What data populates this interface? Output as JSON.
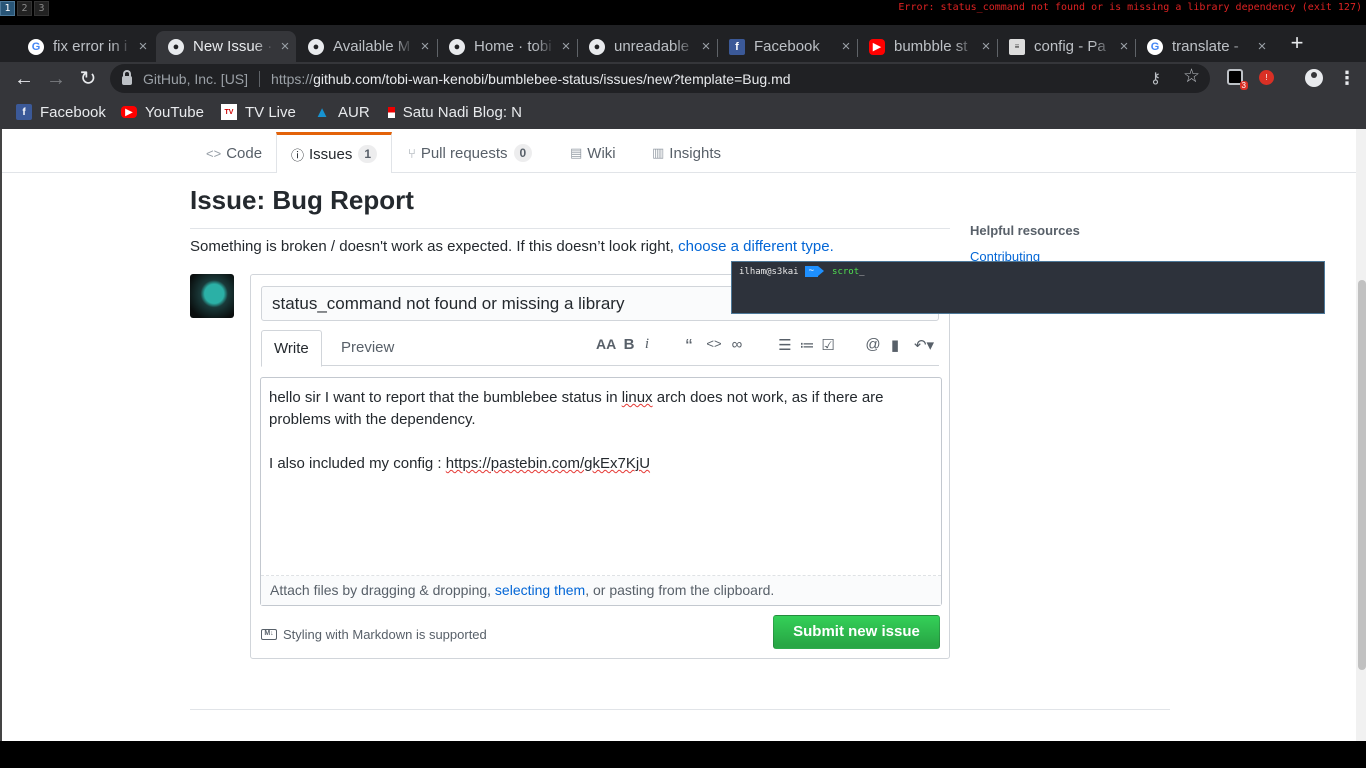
{
  "wm": {
    "workspaces": [
      "1",
      "2",
      "3"
    ],
    "active_workspace": "1",
    "status_text": "Error: status_command not found or is missing a library dependency (exit 127)"
  },
  "browser": {
    "tabs": [
      {
        "label": "fix error in i",
        "icon": "google-icon"
      },
      {
        "label": "New Issue · t",
        "icon": "github-icon",
        "active": true
      },
      {
        "label": "Available M",
        "icon": "github-icon"
      },
      {
        "label": "Home · tobi",
        "icon": "github-icon"
      },
      {
        "label": "unreadable",
        "icon": "github-icon"
      },
      {
        "label": "Facebook",
        "icon": "facebook-icon"
      },
      {
        "label": "bumbble st",
        "icon": "youtube-icon"
      },
      {
        "label": "config - Pa",
        "icon": "pastebin-icon"
      },
      {
        "label": "translate -",
        "icon": "google-icon"
      }
    ],
    "tab_close_glyph": "×",
    "new_tab_glyph": "+",
    "site_identity": "GitHub, Inc. [US]",
    "url_scheme": "https://",
    "url_host": "github.com",
    "url_path": "/tobi-wan-kenobi/bumblebee-status/issues/new?template=Bug.md",
    "ext_badge": "3",
    "ext2_label": "!",
    "bookmarks": [
      {
        "label": "Facebook",
        "icon": "facebook-icon"
      },
      {
        "label": "YouTube",
        "icon": "youtube-icon"
      },
      {
        "label": "TV Live",
        "icon": "tv-icon"
      },
      {
        "label": "AUR",
        "icon": "arch-icon"
      },
      {
        "label": "Satu Nadi Blog: N",
        "icon": "flag-icon"
      }
    ]
  },
  "repo_nav": {
    "code": "Code",
    "issues": "Issues",
    "issues_count": "1",
    "pulls": "Pull requests",
    "pulls_count": "0",
    "wiki": "Wiki",
    "insights": "Insights"
  },
  "issue": {
    "page_title": "Issue: Bug Report",
    "description": "Something is broken / doesn't work as expected. If this doesn’t look right, ",
    "description_link": "choose a different type.",
    "title_value": "status_command not found or missing a library",
    "write_tab": "Write",
    "preview_tab": "Preview",
    "body_line1_before": "hello sir I want to report that the bumblebee status in ",
    "body_line1_spell": "linux",
    "body_line1_after": " arch does not work, as if there are problems with the dependency.",
    "body_line2_before": "I also included my config : ",
    "body_line2_link": "https://pastebin.com/gkEx7KjU",
    "attach_before": "Attach files by dragging & dropping, ",
    "attach_link": "selecting them",
    "attach_after": ", or pasting from the clipboard.",
    "markdown_note": "Styling with Markdown is supported",
    "md_badge": "M↓",
    "submit_label": "Submit new issue"
  },
  "sidebar": {
    "helpful_title": "Helpful resources",
    "contributing": "Contributing"
  },
  "terminal": {
    "user_host": "ilham@s3kai",
    "dir": "~",
    "command": "scrot",
    "cursor": "_"
  }
}
